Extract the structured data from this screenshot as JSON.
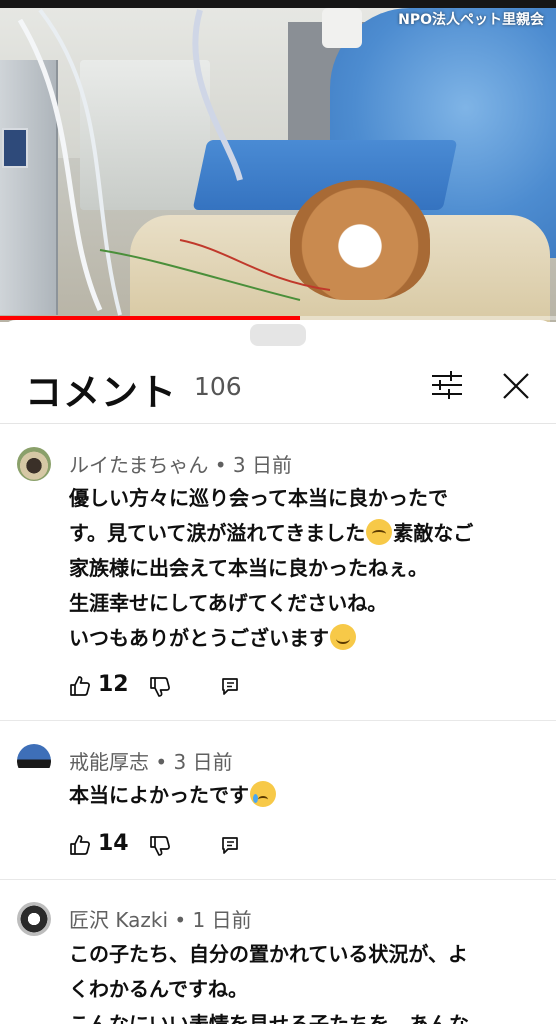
{
  "video": {
    "channel_name": "NPO法人ペット里親会",
    "progress_percent": 54
  },
  "comments_panel": {
    "title": "コメント",
    "count": "106",
    "filter_icon": "sliders-icon",
    "close_icon": "close-icon"
  },
  "comments": [
    {
      "author": "ルイたまちゃん",
      "time": "3 日前",
      "meta": "ルイたまちゃん • 3 日前",
      "lines": [
        "優しい方々に巡り会って本当に良かったで",
        "す。見ていて涙が溢れてきました",
        "家族様に出会えて本当に良かったねぇ。",
        "生涯幸せにしてあげてくださいね。",
        "いつもありがとうございます"
      ],
      "line2_after_emoji": "素敵なご",
      "likes": "12"
    },
    {
      "author": "戒能厚志",
      "time": "3 日前",
      "meta": "戒能厚志 • 3 日前",
      "lines": [
        "本当によかったです"
      ],
      "likes": "14"
    },
    {
      "author": "匠沢 Kazki",
      "time": "1 日前",
      "meta": "匠沢 Kazki • 1 日前",
      "lines": [
        "この子たち、自分の置かれている状況が、よ",
        "くわかるんですね。",
        "こんなにいい表情を見せる子たちを、あんな"
      ]
    }
  ],
  "colors": {
    "progress": "#ff0000",
    "meta_text": "#606060",
    "divider": "#e5e5e5"
  }
}
